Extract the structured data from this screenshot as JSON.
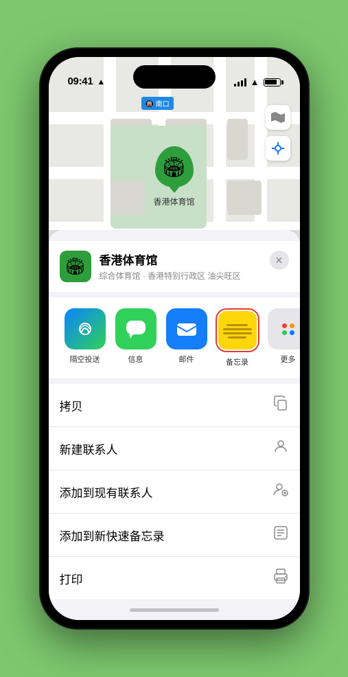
{
  "status_bar": {
    "time": "09:41",
    "location_arrow": "▶"
  },
  "map": {
    "label": "南口",
    "venue_name": "香港体育馆",
    "venue_description": "综合体育馆 · 香港特别行政区 油尖旺区"
  },
  "share_items": [
    {
      "id": "airdrop",
      "label": "隔空投送",
      "type": "airdrop"
    },
    {
      "id": "messages",
      "label": "信息",
      "type": "messages"
    },
    {
      "id": "mail",
      "label": "邮件",
      "type": "mail"
    },
    {
      "id": "notes",
      "label": "备忘录",
      "type": "notes"
    },
    {
      "id": "more",
      "label": "更多",
      "type": "more"
    }
  ],
  "action_items": [
    {
      "id": "copy",
      "label": "拷贝",
      "icon": "copy"
    },
    {
      "id": "new-contact",
      "label": "新建联系人",
      "icon": "person"
    },
    {
      "id": "add-existing",
      "label": "添加到现有联系人",
      "icon": "person-add"
    },
    {
      "id": "add-quick-note",
      "label": "添加到新快速备忘录",
      "icon": "note"
    },
    {
      "id": "print",
      "label": "打印",
      "icon": "print"
    }
  ],
  "close_btn": "✕"
}
